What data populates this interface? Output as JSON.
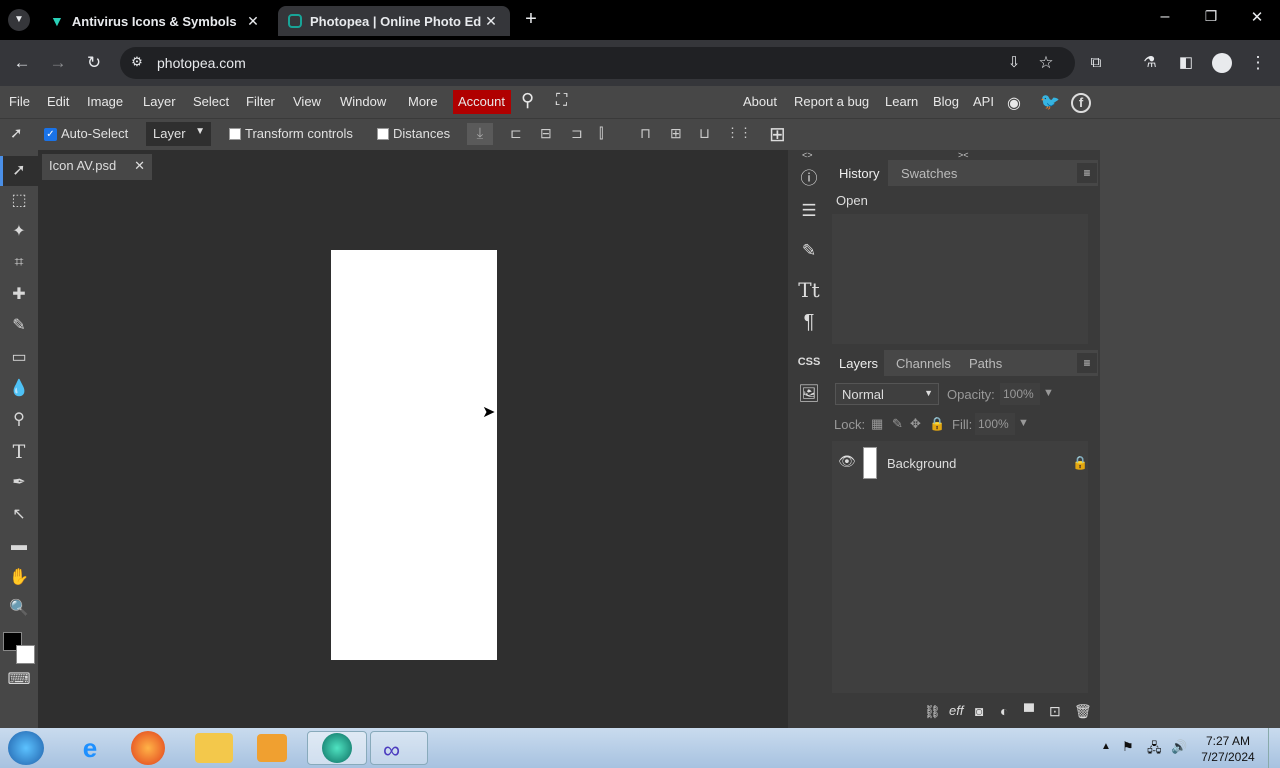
{
  "browser": {
    "tabs": [
      {
        "title": "Antivirus Icons & Symbols",
        "active": false
      },
      {
        "title": "Photopea | Online Photo Editor",
        "active": true
      }
    ],
    "url": "photopea.com"
  },
  "menu": {
    "items": [
      "File",
      "Edit",
      "Image",
      "Layer",
      "Select",
      "Filter",
      "View",
      "Window",
      "More"
    ],
    "account": "Account",
    "right": [
      "About",
      "Report a bug",
      "Learn",
      "Blog",
      "API"
    ]
  },
  "options": {
    "auto_select": "Auto-Select",
    "layer_dropdown": "Layer",
    "transform_controls": "Transform controls",
    "distances": "Distances"
  },
  "document": {
    "tab": "Icon AV.psd"
  },
  "side_icons": {
    "css": "CSS"
  },
  "history": {
    "tabs": [
      "History",
      "Swatches"
    ],
    "entries": [
      "Open"
    ]
  },
  "layers": {
    "tabs": [
      "Layers",
      "Channels",
      "Paths"
    ],
    "blend_mode": "Normal",
    "opacity_label": "Opacity:",
    "opacity": "100%",
    "lock_label": "Lock:",
    "fill_label": "Fill:",
    "fill": "100%",
    "items": [
      {
        "name": "Background"
      }
    ]
  },
  "taskbar": {
    "time": "7:27 AM",
    "date": "7/27/2024"
  }
}
